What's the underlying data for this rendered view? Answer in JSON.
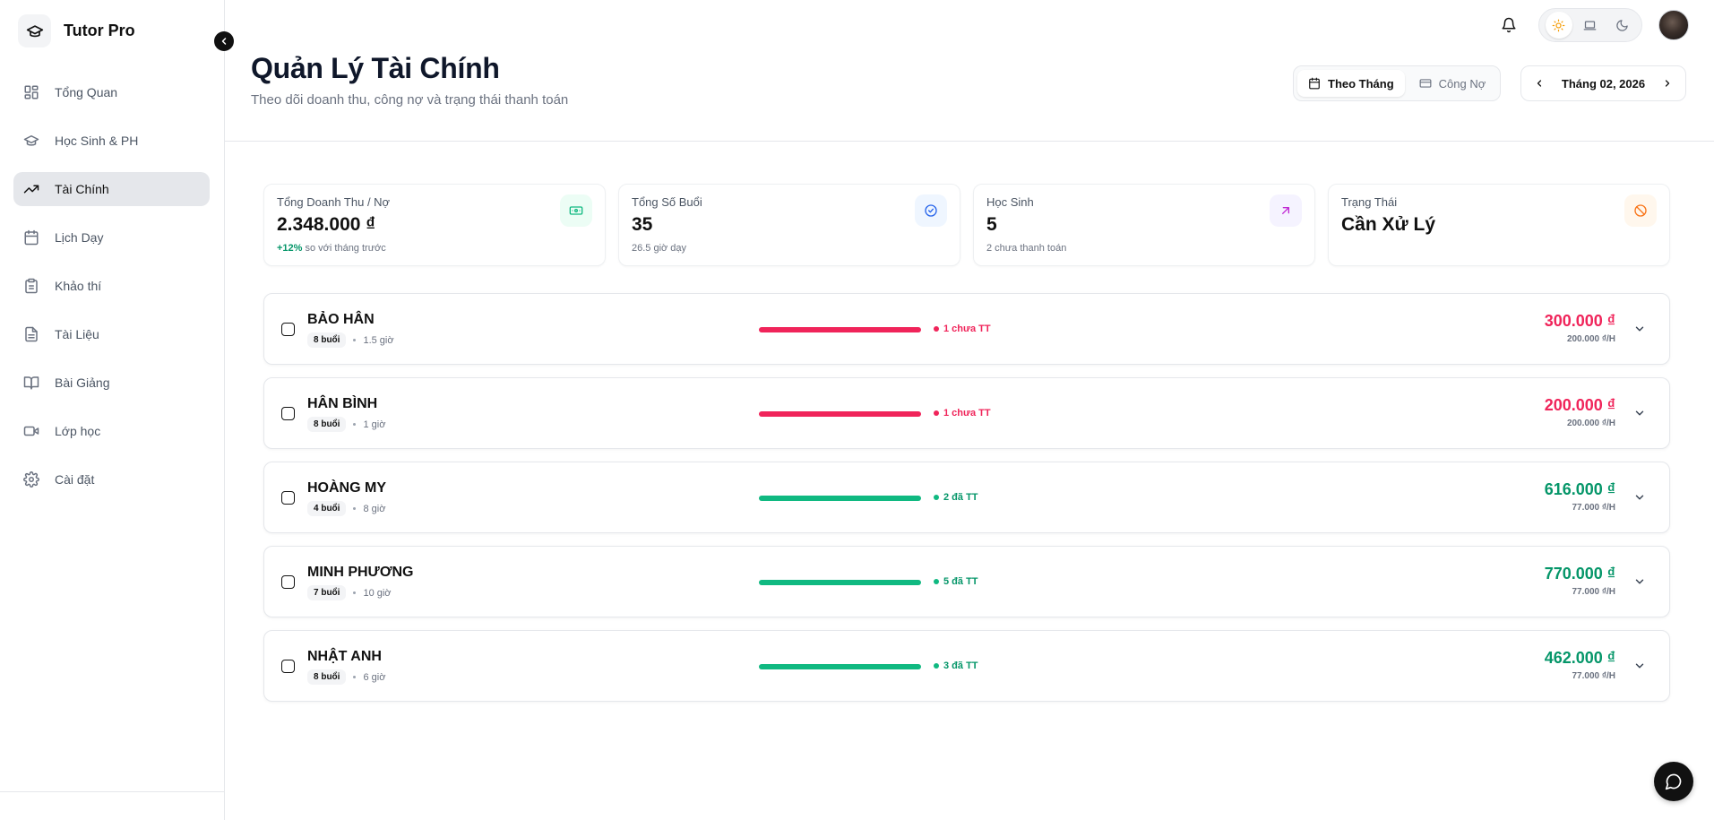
{
  "app": {
    "name": "Tutor Pro"
  },
  "sidebar": {
    "items": [
      {
        "label": "Tổng Quan",
        "icon": "dashboard-icon",
        "active": false
      },
      {
        "label": "Học Sinh & PH",
        "icon": "graduation-cap-icon",
        "active": false
      },
      {
        "label": "Tài Chính",
        "icon": "trending-up-icon",
        "active": true
      },
      {
        "label": "Lịch Dạy",
        "icon": "calendar-icon",
        "active": false
      },
      {
        "label": "Khảo thí",
        "icon": "clipboard-icon",
        "active": false
      },
      {
        "label": "Tài Liệu",
        "icon": "file-icon",
        "active": false
      },
      {
        "label": "Bài Giảng",
        "icon": "book-open-icon",
        "active": false
      },
      {
        "label": "Lớp học",
        "icon": "video-icon",
        "active": false
      },
      {
        "label": "Cài đặt",
        "icon": "gear-icon",
        "active": false
      }
    ]
  },
  "header": {
    "title": "Quản Lý Tài Chính",
    "subtitle": "Theo dõi doanh thu, công nợ và trạng thái thanh toán",
    "tabs": [
      {
        "label": "Theo Tháng",
        "icon": "calendar-icon",
        "active": true
      },
      {
        "label": "Công Nợ",
        "icon": "credit-card-icon",
        "active": false
      }
    ],
    "month": "Tháng 02, 2026"
  },
  "theme": {
    "options": [
      "sun-icon",
      "laptop-icon",
      "moon-icon"
    ],
    "active": "sun-icon"
  },
  "stats": [
    {
      "label": "Tổng Doanh Thu / Nợ",
      "value": "2.348.000 ₫",
      "sub_highlight": "+12%",
      "sub": " so với tháng trước",
      "icon": "banknote-icon",
      "icon_color": "#10b981",
      "icon_bg": "#ecfdf5"
    },
    {
      "label": "Tổng Số Buổi",
      "value": "35",
      "sub_highlight": "",
      "sub": "26.5 giờ dạy",
      "icon": "check-circle-icon",
      "icon_color": "#2563eb",
      "icon_bg": "#eff6ff"
    },
    {
      "label": "Học Sinh",
      "value": "5",
      "sub_highlight": "",
      "sub": "2 chưa thanh toán",
      "icon": "arrow-up-right-icon",
      "icon_color": "#c026d3",
      "icon_bg": "#f5f3ff"
    },
    {
      "label": "Trạng Thái",
      "value": "Cần Xử Lý",
      "sub_highlight": "",
      "sub": "",
      "icon": "ban-icon",
      "icon_color": "#f97316",
      "icon_bg": "#fff7ed"
    }
  ],
  "students": [
    {
      "name": "BẢO HÂN",
      "sessions": "8 buổi",
      "hours": "1.5 giờ",
      "status": "1 chưa TT",
      "paid": false,
      "amount": "300.000 ₫",
      "rate": "200.000 ₫/H"
    },
    {
      "name": "HÂN BÌNH",
      "sessions": "8 buổi",
      "hours": "1 giờ",
      "status": "1 chưa TT",
      "paid": false,
      "amount": "200.000 ₫",
      "rate": "200.000 ₫/H"
    },
    {
      "name": "HOÀNG MY",
      "sessions": "4 buổi",
      "hours": "8 giờ",
      "status": "2 đã TT",
      "paid": true,
      "amount": "616.000 ₫",
      "rate": "77.000 ₫/H"
    },
    {
      "name": "MINH PHƯƠNG",
      "sessions": "7 buổi",
      "hours": "10 giờ",
      "status": "5 đã TT",
      "paid": true,
      "amount": "770.000 ₫",
      "rate": "77.000 ₫/H"
    },
    {
      "name": "NHẬT ANH",
      "sessions": "8 buổi",
      "hours": "6 giờ",
      "status": "3 đã TT",
      "paid": true,
      "amount": "462.000 ₫",
      "rate": "77.000 ₫/H"
    }
  ],
  "colors": {
    "unpaid": "#f0245a",
    "paid": "#10b981",
    "paid_text": "#059669"
  }
}
